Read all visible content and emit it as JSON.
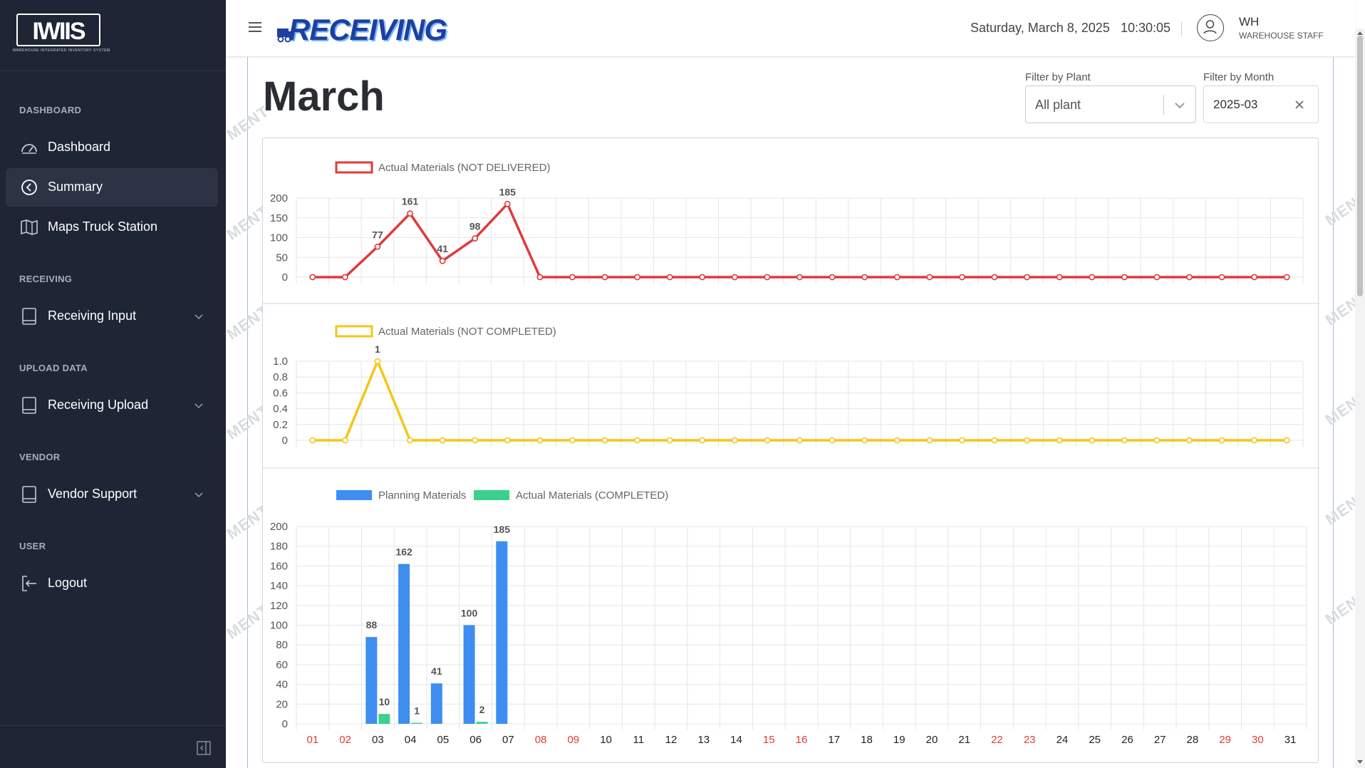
{
  "sidebar": {
    "logo_text": "IWIIS",
    "logo_subtitle": "WAREHOUSE INTEGRATED INVENTORY SYSTEM",
    "sections": [
      {
        "label": "DASHBOARD"
      },
      {
        "label": "RECEIVING"
      },
      {
        "label": "UPLOAD DATA"
      },
      {
        "label": "VENDOR"
      },
      {
        "label": "USER"
      }
    ],
    "items": [
      {
        "label": "Dashboard",
        "icon": "gauge-icon"
      },
      {
        "label": "Summary",
        "icon": "clock-back-icon",
        "active": true
      },
      {
        "label": "Maps Truck Station",
        "icon": "map-icon"
      },
      {
        "label": "Receiving Input",
        "icon": "tablet-icon",
        "expandable": true
      },
      {
        "label": "Receiving Upload",
        "icon": "tablet-icon",
        "expandable": true
      },
      {
        "label": "Vendor Support",
        "icon": "tablet-icon",
        "expandable": true
      },
      {
        "label": "Logout",
        "icon": "logout-icon"
      }
    ]
  },
  "header": {
    "brand": "RECEIVING",
    "date": "Saturday, March 8, 2025",
    "time": "10:30:05",
    "user_name": "WH",
    "user_role": "WAREHOUSE STAFF"
  },
  "page": {
    "title": "March",
    "filter_plant_label": "Filter by Plant",
    "filter_plant_value": "All plant",
    "filter_month_label": "Filter by Month",
    "filter_month_value": "2025-03",
    "watermark": "MENT"
  },
  "colors": {
    "sidebar_bg": "#1e2635",
    "red": "#e03a3a",
    "yellow": "#f5c518",
    "blue": "#3d8ef0",
    "green": "#3ccf8e",
    "weekend_red": "#e53935"
  },
  "chart_data": [
    {
      "type": "line",
      "legend": [
        "Actual Materials (NOT DELIVERED)"
      ],
      "x": [
        "01",
        "02",
        "03",
        "04",
        "05",
        "06",
        "07",
        "08",
        "09",
        "10",
        "11",
        "12",
        "13",
        "14",
        "15",
        "16",
        "17",
        "18",
        "19",
        "20",
        "21",
        "22",
        "23",
        "24",
        "25",
        "26",
        "27",
        "28",
        "29",
        "30",
        "31"
      ],
      "series": [
        {
          "name": "Actual Materials (NOT DELIVERED)",
          "color": "#e03a3a",
          "values": [
            0,
            0,
            77,
            161,
            41,
            98,
            185,
            0,
            0,
            0,
            0,
            0,
            0,
            0,
            0,
            0,
            0,
            0,
            0,
            0,
            0,
            0,
            0,
            0,
            0,
            0,
            0,
            0,
            0,
            0,
            0
          ]
        }
      ],
      "yticks": [
        "200",
        "150",
        "100",
        "50",
        "0"
      ],
      "ylim": [
        0,
        200
      ],
      "grid": true
    },
    {
      "type": "line",
      "legend": [
        "Actual Materials (NOT COMPLETED)"
      ],
      "x": [
        "01",
        "02",
        "03",
        "04",
        "05",
        "06",
        "07",
        "08",
        "09",
        "10",
        "11",
        "12",
        "13",
        "14",
        "15",
        "16",
        "17",
        "18",
        "19",
        "20",
        "21",
        "22",
        "23",
        "24",
        "25",
        "26",
        "27",
        "28",
        "29",
        "30",
        "31"
      ],
      "series": [
        {
          "name": "Actual Materials (NOT COMPLETED)",
          "color": "#f5c518",
          "values": [
            0,
            0,
            1,
            0,
            0,
            0,
            0,
            0,
            0,
            0,
            0,
            0,
            0,
            0,
            0,
            0,
            0,
            0,
            0,
            0,
            0,
            0,
            0,
            0,
            0,
            0,
            0,
            0,
            0,
            0,
            0
          ]
        }
      ],
      "yticks": [
        "1.0",
        "0.8",
        "0.6",
        "0.4",
        "0.2",
        "0"
      ],
      "ylim": [
        0,
        1
      ],
      "grid": true
    },
    {
      "type": "bar",
      "legend": [
        "Planning Materials",
        "Actual Materials (COMPLETED)"
      ],
      "categories": [
        "01",
        "02",
        "03",
        "04",
        "05",
        "06",
        "07",
        "08",
        "09",
        "10",
        "11",
        "12",
        "13",
        "14",
        "15",
        "16",
        "17",
        "18",
        "19",
        "20",
        "21",
        "22",
        "23",
        "24",
        "25",
        "26",
        "27",
        "28",
        "29",
        "30",
        "31"
      ],
      "red_days": [
        "01",
        "02",
        "08",
        "09",
        "15",
        "16",
        "22",
        "23",
        "29",
        "30"
      ],
      "series": [
        {
          "name": "Planning Materials",
          "color": "#3d8ef0",
          "values": [
            0,
            0,
            88,
            162,
            41,
            100,
            185,
            0,
            0,
            0,
            0,
            0,
            0,
            0,
            0,
            0,
            0,
            0,
            0,
            0,
            0,
            0,
            0,
            0,
            0,
            0,
            0,
            0,
            0,
            0,
            0
          ]
        },
        {
          "name": "Actual Materials (COMPLETED)",
          "color": "#3ccf8e",
          "values": [
            0,
            0,
            10,
            1,
            0,
            2,
            0,
            0,
            0,
            0,
            0,
            0,
            0,
            0,
            0,
            0,
            0,
            0,
            0,
            0,
            0,
            0,
            0,
            0,
            0,
            0,
            0,
            0,
            0,
            0,
            0
          ]
        }
      ],
      "yticks": [
        "200",
        "180",
        "160",
        "140",
        "120",
        "100",
        "80",
        "60",
        "40",
        "20",
        "0"
      ],
      "ylim": [
        0,
        200
      ],
      "grid": true
    }
  ]
}
